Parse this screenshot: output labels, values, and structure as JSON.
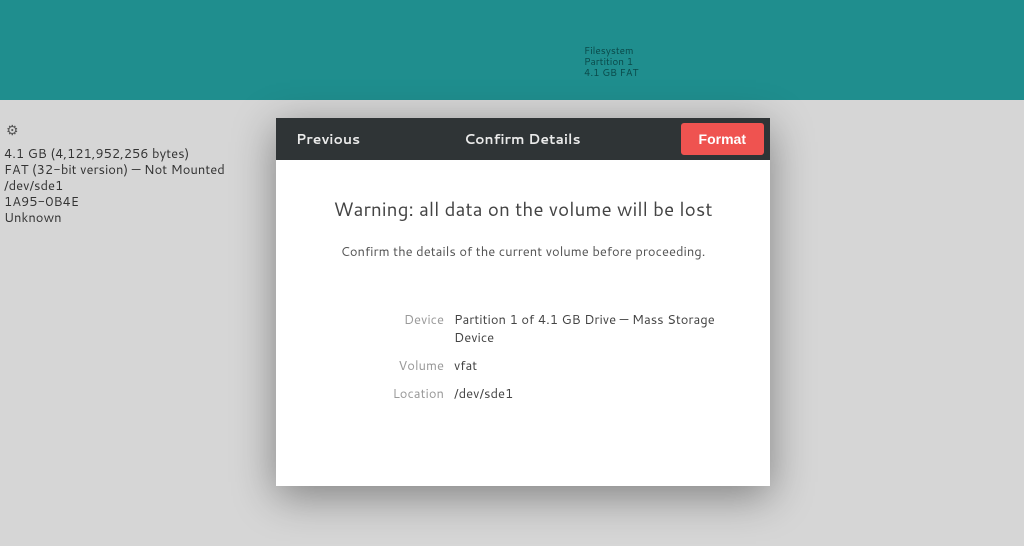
{
  "banner": {
    "line1": "Filesystem",
    "line2": "Partition 1",
    "line3": "4.1 GB FAT"
  },
  "sidebar": {
    "size": "4.1 GB (4,121,952,256 bytes)",
    "fs": "FAT (32-bit version) — Not Mounted",
    "device": "/dev/sde1",
    "uuid": "1A95-0B4E",
    "extra": "Unknown"
  },
  "dialog": {
    "previous": "Previous",
    "title": "Confirm Details",
    "format": "Format",
    "warn_title": "Warning: all data on the volume will be lost",
    "warn_sub": "Confirm the details of the current volume before proceeding.",
    "labels": {
      "device": "Device",
      "volume": "Volume",
      "location": "Location"
    },
    "values": {
      "device": "Partition 1 of 4.1 GB Drive — Mass Storage Device",
      "volume": "vfat",
      "location": "/dev/sde1"
    }
  }
}
